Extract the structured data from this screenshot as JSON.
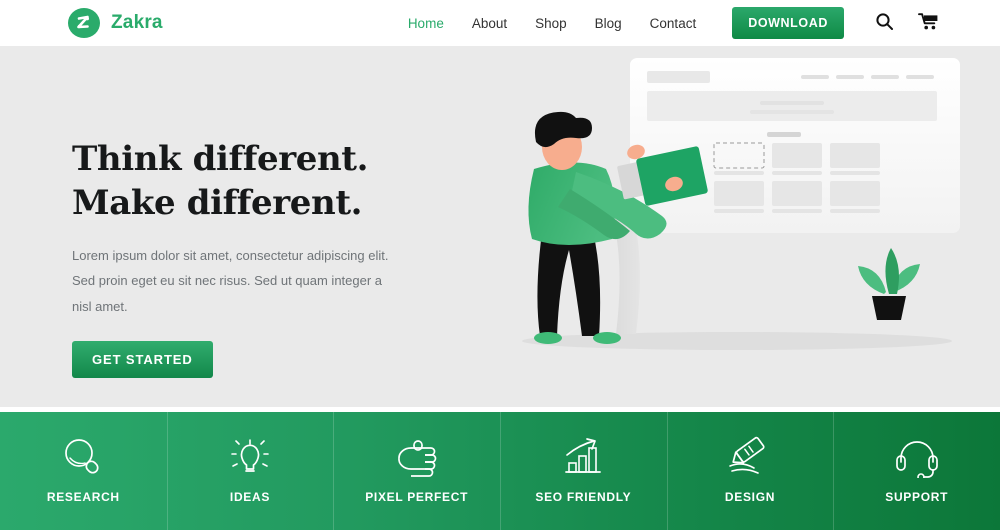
{
  "theme": {
    "brand_green": "#2aab6b",
    "header_bg": "#ffffff",
    "hero_bg": "#eaeaea",
    "features_gradient_from": "#2ba96c",
    "features_gradient_to": "#0c7739",
    "heading_color": "#17191a",
    "body_text_color": "#6f7478"
  },
  "header": {
    "logo_icon": "zakra-logo-icon",
    "brand_name": "Zakra",
    "nav": [
      {
        "label": "Home",
        "active": true
      },
      {
        "label": "About",
        "active": false
      },
      {
        "label": "Shop",
        "active": false
      },
      {
        "label": "Blog",
        "active": false
      },
      {
        "label": "Contact",
        "active": false
      }
    ],
    "download_label": "DOWNLOAD",
    "search_icon": "search-icon",
    "cart_icon": "shopping-cart-icon"
  },
  "hero": {
    "title_line1": "Think different.",
    "title_line2": "Make different.",
    "paragraph": "Lorem ipsum dolor sit amet, consectetur adipiscing elit. Sed proin eget eu sit nec risus. Sed ut quam integer a nisl amet.",
    "cta_label": "GET STARTED",
    "illustration": "person-placing-card-on-website-wireframe-illustration"
  },
  "features": [
    {
      "label": "RESEARCH",
      "icon": "magnifier-icon"
    },
    {
      "label": "IDEAS",
      "icon": "lightbulb-icon"
    },
    {
      "label": "PIXEL PERFECT",
      "icon": "hand-icon"
    },
    {
      "label": "SEO FRIENDLY",
      "icon": "bar-chart-arrow-icon"
    },
    {
      "label": "DESIGN",
      "icon": "pen-stroke-icon"
    },
    {
      "label": "SUPPORT",
      "icon": "headset-icon"
    }
  ]
}
